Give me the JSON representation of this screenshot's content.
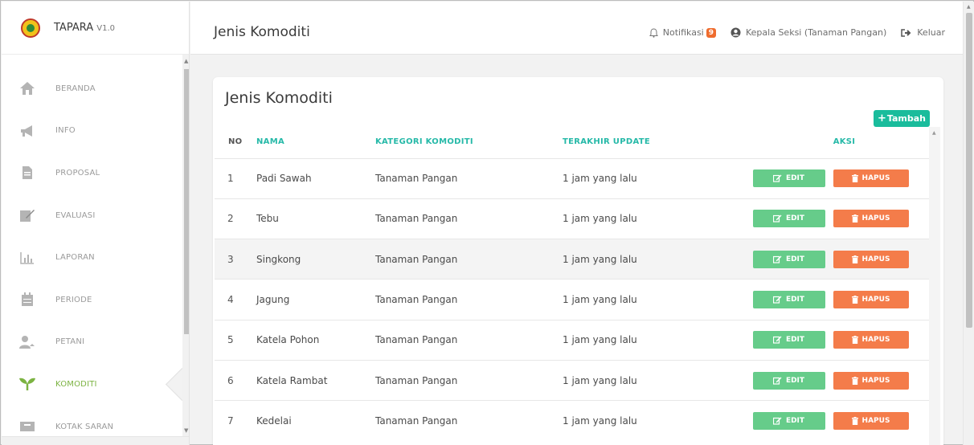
{
  "app": {
    "name": "TAPARA",
    "version": "V1.0"
  },
  "sidebar": {
    "items": [
      {
        "label": "BERANDA",
        "icon": "home-icon"
      },
      {
        "label": "INFO",
        "icon": "megaphone-icon"
      },
      {
        "label": "PROPOSAL",
        "icon": "document-icon"
      },
      {
        "label": "EVALUASI",
        "icon": "signature-icon"
      },
      {
        "label": "LAPORAN",
        "icon": "bar-chart-icon"
      },
      {
        "label": "PERIODE",
        "icon": "calendar-icon"
      },
      {
        "label": "PETANI",
        "icon": "users-icon"
      },
      {
        "label": "KOMODITI",
        "icon": "sprout-icon",
        "active": true
      },
      {
        "label": "KOTAK SARAN",
        "icon": "inbox-icon"
      }
    ]
  },
  "header": {
    "title": "Jenis Komoditi",
    "notif_label": "Notifikasi",
    "notif_count": "9",
    "user_label": "Kepala Seksi (Tanaman Pangan)",
    "logout_label": "Keluar"
  },
  "card": {
    "title": "Jenis Komoditi",
    "add_label": "Tambah"
  },
  "table": {
    "headers": {
      "no": "NO",
      "nama": "NAMA",
      "kategori": "KATEGORI KOMODITI",
      "update": "TERAKHIR UPDATE",
      "aksi": "AKSI"
    },
    "edit_label": "EDIT",
    "delete_label": "HAPUS",
    "rows": [
      {
        "no": "1",
        "nama": "Padi Sawah",
        "kategori": "Tanaman Pangan",
        "update": "1 jam yang lalu"
      },
      {
        "no": "2",
        "nama": "Tebu",
        "kategori": "Tanaman Pangan",
        "update": "1 jam yang lalu"
      },
      {
        "no": "3",
        "nama": "Singkong",
        "kategori": "Tanaman Pangan",
        "update": "1 jam yang lalu"
      },
      {
        "no": "4",
        "nama": "Jagung",
        "kategori": "Tanaman Pangan",
        "update": "1 jam yang lalu"
      },
      {
        "no": "5",
        "nama": "Katela Pohon",
        "kategori": "Tanaman Pangan",
        "update": "1 jam yang lalu"
      },
      {
        "no": "6",
        "nama": "Katela Rambat",
        "kategori": "Tanaman Pangan",
        "update": "1 jam yang lalu"
      },
      {
        "no": "7",
        "nama": "Kedelai",
        "kategori": "Tanaman Pangan",
        "update": "1 jam yang lalu"
      }
    ]
  },
  "colors": {
    "accent": "#1abc9c",
    "edit": "#66cc8a",
    "delete": "#f47c4a",
    "active_menu": "#7cb342"
  }
}
